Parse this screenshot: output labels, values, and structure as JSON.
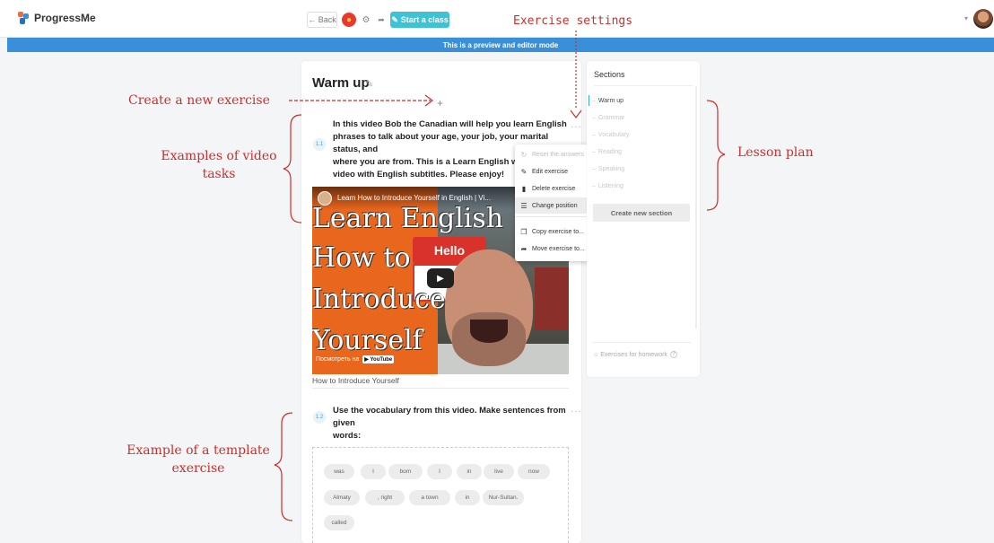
{
  "topbar": {
    "logo_text": "ProgressMe",
    "back_label": "← Back",
    "start_label": "Start a class"
  },
  "preview_banner": "This is a preview and editor mode",
  "lesson": {
    "title": "Warm up",
    "exercises": [
      {
        "number": "1.1",
        "text_lines": [
          "In this video Bob the Canadian will help you learn English",
          "phrases to talk about your age, your job, your marital status, and",
          "where you are from. This is a Learn English with Bob",
          "video with English subtitles. Please enjoy!"
        ],
        "video": {
          "title": "Learn How to Introduce Yourself in English | Vi...",
          "overlay_lines": [
            "Learn English",
            "How to",
            "Introduce",
            "Yourself"
          ],
          "hello": "Hello",
          "watch_on": "Посмотреть на",
          "youtube": "YouTube"
        },
        "caption": "How to Introduce Yourself"
      },
      {
        "number": "1.2",
        "text_lines": [
          "Use the vocabulary from this video. Make sentences from given",
          "words:"
        ],
        "words": [
          "was",
          "I",
          "born",
          "I",
          "in",
          "live",
          "now",
          "Almaty",
          ", right",
          "a town",
          "in",
          "Nur-Sultan.",
          "called"
        ]
      }
    ]
  },
  "menu": {
    "items": [
      {
        "label": "Reset the answers",
        "icon": "reset-icon",
        "disabled": true
      },
      {
        "label": "Edit exercise",
        "icon": "pencil-icon"
      },
      {
        "label": "Delete exercise",
        "icon": "trash-icon"
      },
      {
        "label": "Change position",
        "icon": "reorder-icon",
        "active": true
      },
      {
        "label": "Copy exercise to...",
        "icon": "copy-icon"
      },
      {
        "label": "Move exercise to...",
        "icon": "arrow-icon"
      }
    ]
  },
  "sections": {
    "title": "Sections",
    "items": [
      "Warm up",
      "Grammar",
      "Vocabulary",
      "Reading",
      "Speaking",
      "Listening"
    ],
    "create_label": "Create new section",
    "homework_label": "Exercises for homework"
  },
  "annotations": {
    "exercise_settings": "Exercise settings",
    "create_new": "Create a new exercise",
    "video_tasks": [
      "Examples of video",
      "tasks"
    ],
    "lesson_plan": "Lesson plan",
    "template": [
      "Example of a template",
      "exercise"
    ]
  },
  "colors": {
    "accent": "#3aa7d6",
    "preview_bar": "#3a8fd9",
    "start_button": "#3cc3d8",
    "annotation": "#c9302c"
  }
}
